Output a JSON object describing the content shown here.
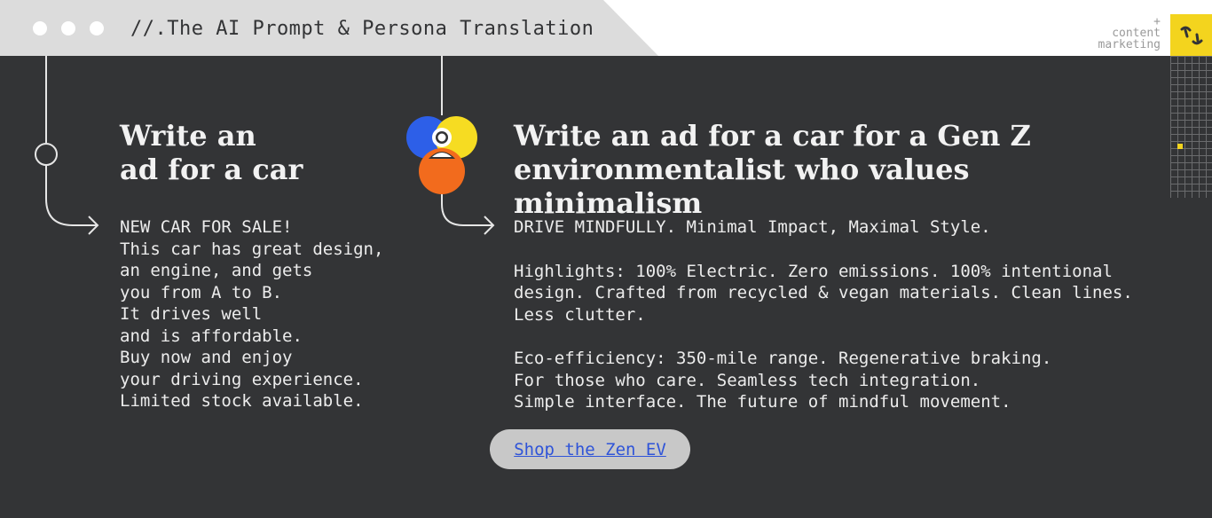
{
  "header": {
    "title": "//.The AI Prompt & Persona Translation",
    "brand_lines": [
      "+",
      "content",
      "marketing"
    ],
    "logo_icon": "brand-mark-icon"
  },
  "left": {
    "heading_lines": [
      "Write an",
      "ad for a car"
    ],
    "body_lines": [
      "NEW CAR FOR SALE!",
      "This car has great design,",
      "an engine, and gets",
      "you from A to B.",
      "It drives well",
      "and is affordable.",
      "Buy now and enjoy",
      "your driving experience.",
      "Limited stock available."
    ]
  },
  "right": {
    "heading_lines": [
      "Write an ad for a car for a Gen Z",
      "environmentalist who values minimalism"
    ],
    "paragraphs": [
      [
        "DRIVE MINDFULLY. Minimal Impact, Maximal Style."
      ],
      [
        "Highlights: 100% Electric. Zero emissions. 100% intentional",
        "design. Crafted from recycled & vegan materials. Clean lines.",
        "Less clutter."
      ],
      [
        "Eco-efficiency: 350-mile range. Regenerative braking.",
        "For those who care. Seamless tech integration.",
        "Simple interface. The future of mindful movement."
      ]
    ]
  },
  "cta": {
    "label": "Shop the Zen EV"
  },
  "colors": {
    "background": "#333436",
    "accent_yellow": "#f3d41e",
    "persona_blue": "#2d5fe8",
    "persona_orange": "#f26b1d",
    "link_blue": "#2f54d8"
  }
}
